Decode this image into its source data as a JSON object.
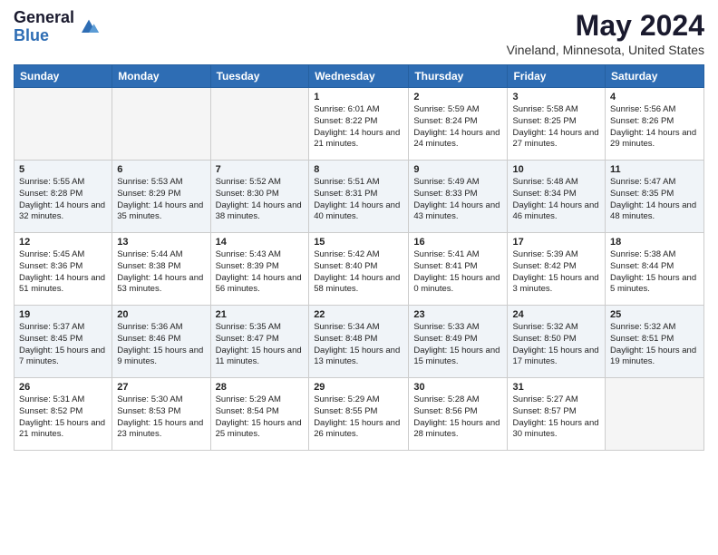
{
  "logo": {
    "general": "General",
    "blue": "Blue"
  },
  "title": "May 2024",
  "location": "Vineland, Minnesota, United States",
  "headers": [
    "Sunday",
    "Monday",
    "Tuesday",
    "Wednesday",
    "Thursday",
    "Friday",
    "Saturday"
  ],
  "weeks": [
    [
      {
        "day": "",
        "sunrise": "",
        "sunset": "",
        "daylight": ""
      },
      {
        "day": "",
        "sunrise": "",
        "sunset": "",
        "daylight": ""
      },
      {
        "day": "",
        "sunrise": "",
        "sunset": "",
        "daylight": ""
      },
      {
        "day": "1",
        "sunrise": "Sunrise: 6:01 AM",
        "sunset": "Sunset: 8:22 PM",
        "daylight": "Daylight: 14 hours and 21 minutes."
      },
      {
        "day": "2",
        "sunrise": "Sunrise: 5:59 AM",
        "sunset": "Sunset: 8:24 PM",
        "daylight": "Daylight: 14 hours and 24 minutes."
      },
      {
        "day": "3",
        "sunrise": "Sunrise: 5:58 AM",
        "sunset": "Sunset: 8:25 PM",
        "daylight": "Daylight: 14 hours and 27 minutes."
      },
      {
        "day": "4",
        "sunrise": "Sunrise: 5:56 AM",
        "sunset": "Sunset: 8:26 PM",
        "daylight": "Daylight: 14 hours and 29 minutes."
      }
    ],
    [
      {
        "day": "5",
        "sunrise": "Sunrise: 5:55 AM",
        "sunset": "Sunset: 8:28 PM",
        "daylight": "Daylight: 14 hours and 32 minutes."
      },
      {
        "day": "6",
        "sunrise": "Sunrise: 5:53 AM",
        "sunset": "Sunset: 8:29 PM",
        "daylight": "Daylight: 14 hours and 35 minutes."
      },
      {
        "day": "7",
        "sunrise": "Sunrise: 5:52 AM",
        "sunset": "Sunset: 8:30 PM",
        "daylight": "Daylight: 14 hours and 38 minutes."
      },
      {
        "day": "8",
        "sunrise": "Sunrise: 5:51 AM",
        "sunset": "Sunset: 8:31 PM",
        "daylight": "Daylight: 14 hours and 40 minutes."
      },
      {
        "day": "9",
        "sunrise": "Sunrise: 5:49 AM",
        "sunset": "Sunset: 8:33 PM",
        "daylight": "Daylight: 14 hours and 43 minutes."
      },
      {
        "day": "10",
        "sunrise": "Sunrise: 5:48 AM",
        "sunset": "Sunset: 8:34 PM",
        "daylight": "Daylight: 14 hours and 46 minutes."
      },
      {
        "day": "11",
        "sunrise": "Sunrise: 5:47 AM",
        "sunset": "Sunset: 8:35 PM",
        "daylight": "Daylight: 14 hours and 48 minutes."
      }
    ],
    [
      {
        "day": "12",
        "sunrise": "Sunrise: 5:45 AM",
        "sunset": "Sunset: 8:36 PM",
        "daylight": "Daylight: 14 hours and 51 minutes."
      },
      {
        "day": "13",
        "sunrise": "Sunrise: 5:44 AM",
        "sunset": "Sunset: 8:38 PM",
        "daylight": "Daylight: 14 hours and 53 minutes."
      },
      {
        "day": "14",
        "sunrise": "Sunrise: 5:43 AM",
        "sunset": "Sunset: 8:39 PM",
        "daylight": "Daylight: 14 hours and 56 minutes."
      },
      {
        "day": "15",
        "sunrise": "Sunrise: 5:42 AM",
        "sunset": "Sunset: 8:40 PM",
        "daylight": "Daylight: 14 hours and 58 minutes."
      },
      {
        "day": "16",
        "sunrise": "Sunrise: 5:41 AM",
        "sunset": "Sunset: 8:41 PM",
        "daylight": "Daylight: 15 hours and 0 minutes."
      },
      {
        "day": "17",
        "sunrise": "Sunrise: 5:39 AM",
        "sunset": "Sunset: 8:42 PM",
        "daylight": "Daylight: 15 hours and 3 minutes."
      },
      {
        "day": "18",
        "sunrise": "Sunrise: 5:38 AM",
        "sunset": "Sunset: 8:44 PM",
        "daylight": "Daylight: 15 hours and 5 minutes."
      }
    ],
    [
      {
        "day": "19",
        "sunrise": "Sunrise: 5:37 AM",
        "sunset": "Sunset: 8:45 PM",
        "daylight": "Daylight: 15 hours and 7 minutes."
      },
      {
        "day": "20",
        "sunrise": "Sunrise: 5:36 AM",
        "sunset": "Sunset: 8:46 PM",
        "daylight": "Daylight: 15 hours and 9 minutes."
      },
      {
        "day": "21",
        "sunrise": "Sunrise: 5:35 AM",
        "sunset": "Sunset: 8:47 PM",
        "daylight": "Daylight: 15 hours and 11 minutes."
      },
      {
        "day": "22",
        "sunrise": "Sunrise: 5:34 AM",
        "sunset": "Sunset: 8:48 PM",
        "daylight": "Daylight: 15 hours and 13 minutes."
      },
      {
        "day": "23",
        "sunrise": "Sunrise: 5:33 AM",
        "sunset": "Sunset: 8:49 PM",
        "daylight": "Daylight: 15 hours and 15 minutes."
      },
      {
        "day": "24",
        "sunrise": "Sunrise: 5:32 AM",
        "sunset": "Sunset: 8:50 PM",
        "daylight": "Daylight: 15 hours and 17 minutes."
      },
      {
        "day": "25",
        "sunrise": "Sunrise: 5:32 AM",
        "sunset": "Sunset: 8:51 PM",
        "daylight": "Daylight: 15 hours and 19 minutes."
      }
    ],
    [
      {
        "day": "26",
        "sunrise": "Sunrise: 5:31 AM",
        "sunset": "Sunset: 8:52 PM",
        "daylight": "Daylight: 15 hours and 21 minutes."
      },
      {
        "day": "27",
        "sunrise": "Sunrise: 5:30 AM",
        "sunset": "Sunset: 8:53 PM",
        "daylight": "Daylight: 15 hours and 23 minutes."
      },
      {
        "day": "28",
        "sunrise": "Sunrise: 5:29 AM",
        "sunset": "Sunset: 8:54 PM",
        "daylight": "Daylight: 15 hours and 25 minutes."
      },
      {
        "day": "29",
        "sunrise": "Sunrise: 5:29 AM",
        "sunset": "Sunset: 8:55 PM",
        "daylight": "Daylight: 15 hours and 26 minutes."
      },
      {
        "day": "30",
        "sunrise": "Sunrise: 5:28 AM",
        "sunset": "Sunset: 8:56 PM",
        "daylight": "Daylight: 15 hours and 28 minutes."
      },
      {
        "day": "31",
        "sunrise": "Sunrise: 5:27 AM",
        "sunset": "Sunset: 8:57 PM",
        "daylight": "Daylight: 15 hours and 30 minutes."
      },
      {
        "day": "",
        "sunrise": "",
        "sunset": "",
        "daylight": ""
      }
    ]
  ]
}
